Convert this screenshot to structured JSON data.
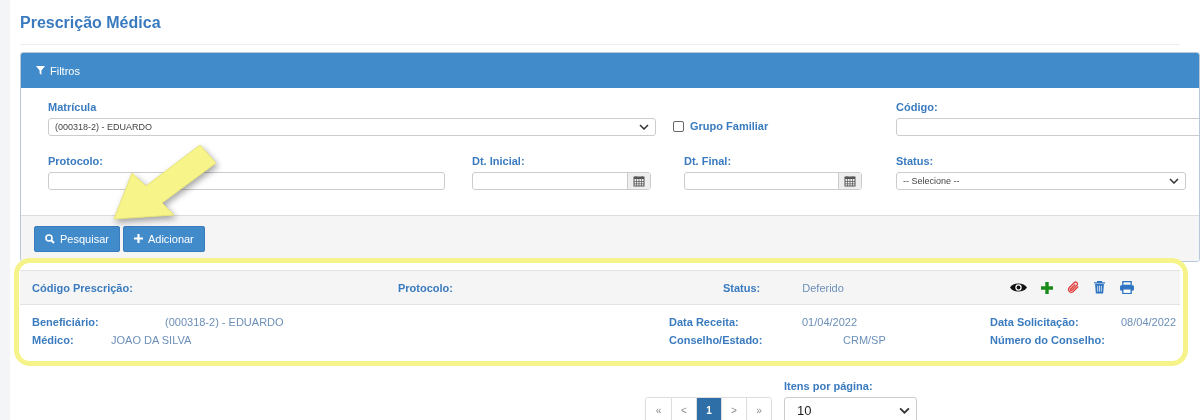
{
  "title": "Prescrição Médica",
  "filters": {
    "header": "Filtros",
    "fields": [
      {
        "kind": "select",
        "label": "Matrícula",
        "value": "(000318-2) - EDUARDO"
      },
      {
        "kind": "checkbox",
        "label": "Grupo Familiar",
        "checked": false
      },
      {
        "kind": "text",
        "label": "Código:"
      },
      {
        "kind": "text",
        "label": "Protocolo:"
      },
      {
        "kind": "date",
        "label": "Dt. Inicial:"
      },
      {
        "kind": "date",
        "label": "Dt. Final:"
      },
      {
        "kind": "select",
        "label": "Status:",
        "value": "-- Selecione --"
      }
    ],
    "buttons": [
      {
        "kind": "search",
        "label": "Pesquisar"
      },
      {
        "kind": "add",
        "label": "Adicionar"
      }
    ]
  },
  "result": {
    "header": [
      {
        "label": "Código Prescrição:"
      },
      {
        "label": "Protocolo:"
      },
      {
        "label": "Status:",
        "value": "Deferido"
      }
    ],
    "actions": [
      {
        "kind": "view"
      },
      {
        "kind": "add"
      },
      {
        "kind": "attach"
      },
      {
        "kind": "delete"
      },
      {
        "kind": "print"
      }
    ],
    "rows": [
      [
        {
          "label": "Beneficiário:",
          "value": "(000318-2) - EDUARDO"
        },
        {
          "label": "Data Receita:",
          "value": "01/04/2022"
        },
        {
          "label": "Data Solicitação:",
          "value": "08/04/2022"
        }
      ],
      [
        {
          "label": "Médico:",
          "value": "JOAO DA SILVA"
        },
        {
          "label": "Conselho/Estado:",
          "value": "CRM/SP"
        },
        {
          "label": "Número do Conselho:"
        }
      ]
    ]
  },
  "pagination": [
    {
      "label": "«",
      "selected": false
    },
    {
      "label": "<",
      "selected": false
    },
    {
      "label": "1",
      "selected": true
    },
    {
      "label": ">",
      "selected": false
    },
    {
      "label": "»",
      "selected": false
    }
  ],
  "per_page": {
    "label": "Itens por página:",
    "value": "10"
  }
}
